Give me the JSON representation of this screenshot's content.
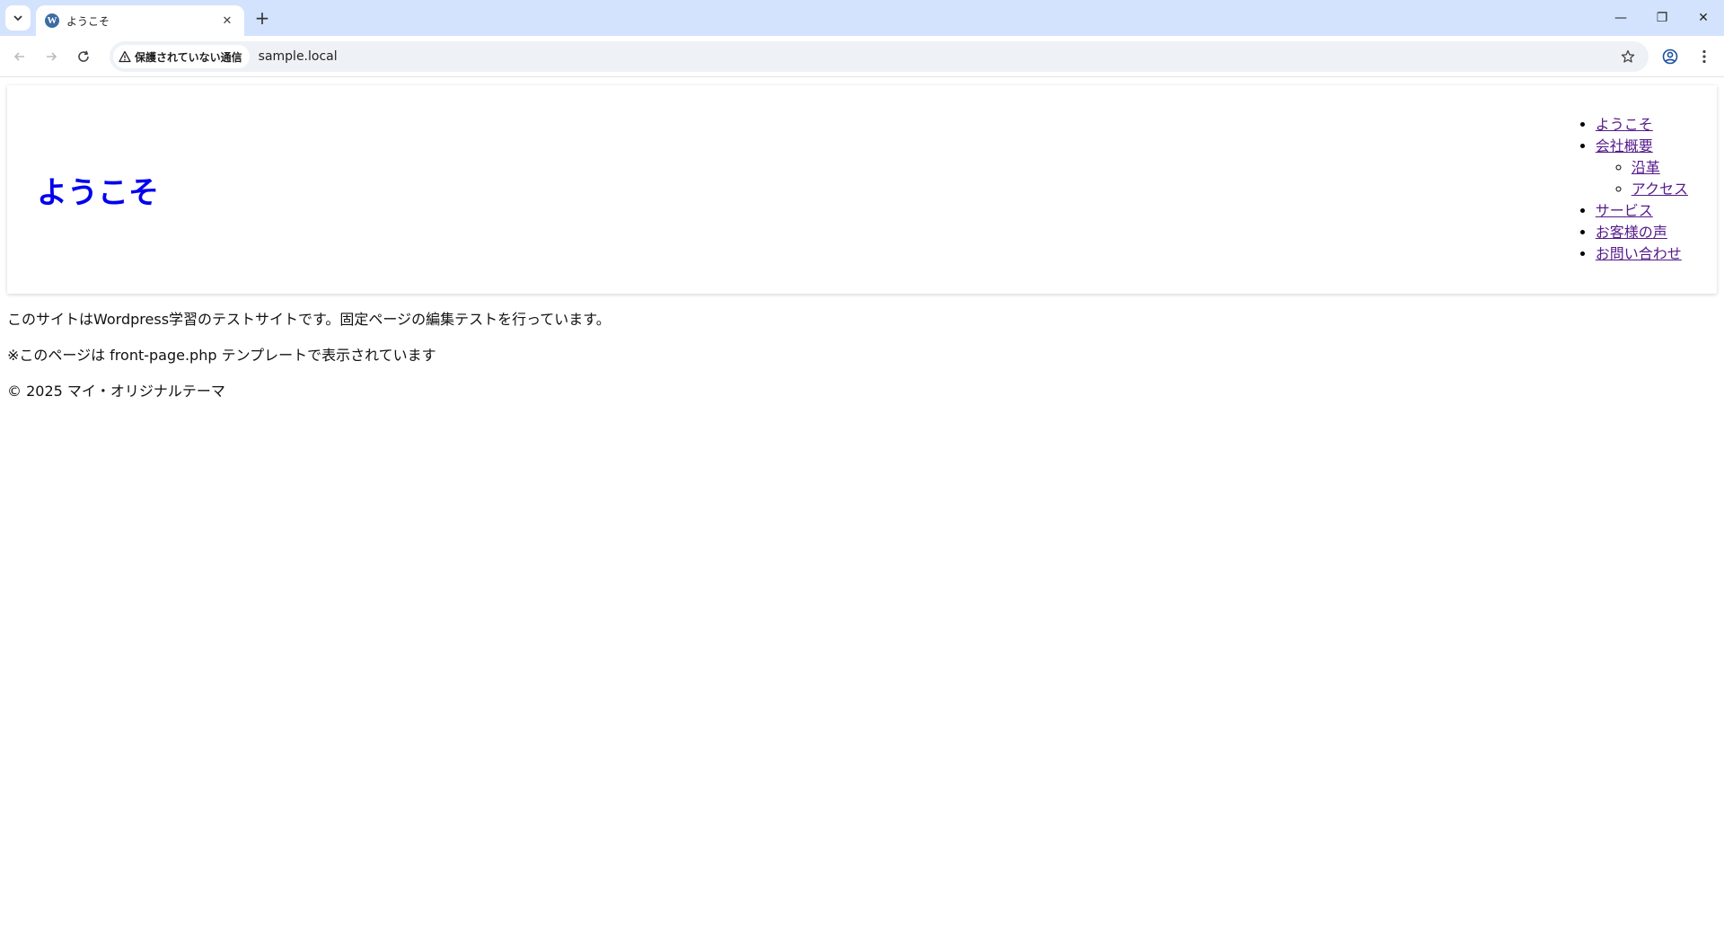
{
  "browser": {
    "tab_title": "ようこそ",
    "tab_close": "✕",
    "new_tab": "+",
    "security_label": "保護されていない通信",
    "url": "sample.local",
    "icons": {
      "tab_search": "chevron-down-icon",
      "favicon": "wordpress-icon",
      "back": "arrow-left-icon",
      "forward": "arrow-right-icon",
      "reload": "reload-icon",
      "warning": "warning-icon",
      "bookmark": "star-icon",
      "profile": "profile-icon",
      "menu": "kebab-menu-icon"
    },
    "window_controls": {
      "minimize": "—",
      "restore": "❐",
      "close": "✕"
    }
  },
  "page": {
    "site_title": "ようこそ",
    "nav": {
      "items": [
        {
          "label": "ようこそ"
        },
        {
          "label": "会社概要",
          "children": [
            {
              "label": "沿革"
            },
            {
              "label": "アクセス"
            }
          ]
        },
        {
          "label": "サービス"
        },
        {
          "label": "お客様の声"
        },
        {
          "label": "お問い合わせ"
        }
      ]
    },
    "paragraphs": [
      "このサイトはWordpress学習のテストサイトです。固定ページの編集テストを行っています。",
      "※このページは front-page.php テンプレートで表示されています"
    ],
    "footer": "© 2025 マイ・オリジナルテーマ",
    "colors": {
      "site_title": "#0000ee",
      "nav_link": "#551a8b",
      "tabbar_bg": "#d3e3fd",
      "omnibox_bg": "#eef1f6"
    }
  }
}
